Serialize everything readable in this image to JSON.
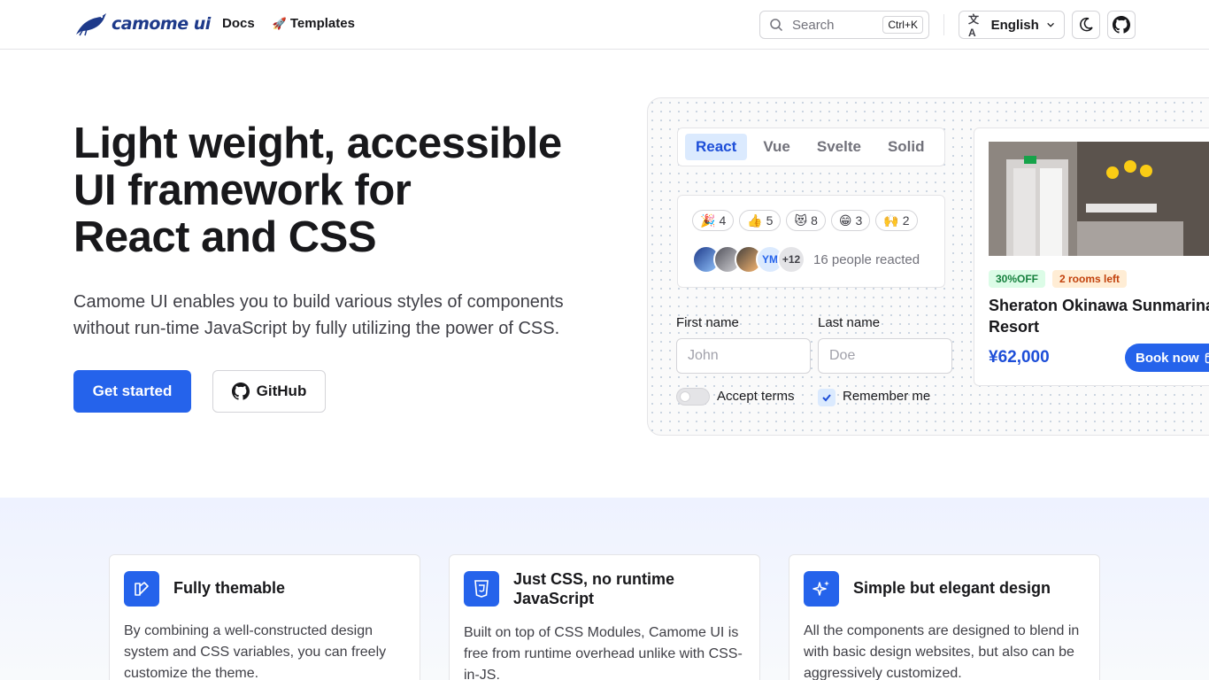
{
  "header": {
    "logo_text": "camome ui",
    "nav": [
      {
        "label": "Docs",
        "emoji": ""
      },
      {
        "label": "Templates",
        "emoji": "🚀"
      }
    ],
    "search": {
      "placeholder": "Search",
      "shortcut": "Ctrl+K"
    },
    "language": "English"
  },
  "hero": {
    "title_lines": [
      "Light weight, accessible",
      "UI framework for",
      "React and CSS"
    ],
    "subtitle": "Camome UI enables you to build various styles of components without run-time JavaScript by fully utilizing the power of CSS.",
    "primary_button": "Get started",
    "secondary_button": "GitHub"
  },
  "showcase": {
    "tabs": [
      "React",
      "Vue",
      "Svelte",
      "Solid"
    ],
    "active_tab": "React",
    "reactions": [
      {
        "emoji": "🎉",
        "count": "4"
      },
      {
        "emoji": "👍",
        "count": "5"
      },
      {
        "emoji": "😻",
        "count": "8"
      },
      {
        "emoji": "😁",
        "count": "3"
      },
      {
        "emoji": "🙌",
        "count": "2"
      }
    ],
    "avatar_initials": "YM",
    "avatar_more": "+12",
    "reacted_text": "16 people reacted",
    "form": {
      "first_name_label": "First name",
      "first_name_placeholder": "John",
      "last_name_label": "Last name",
      "last_name_placeholder": "Doe",
      "accept_terms": "Accept terms",
      "remember_me": "Remember me",
      "accept_terms_checked": false,
      "remember_me_checked": true
    },
    "hotel": {
      "discount_badge": "30%OFF",
      "rooms_badge": "2 rooms left",
      "name_lines": [
        "Sheraton Okinawa Sunmarina",
        "Resort"
      ],
      "price": "¥62,000",
      "book_button": "Book now"
    }
  },
  "features": [
    {
      "title": "Fully themable",
      "description": "By combining a well-constructed design system and CSS variables, you can freely customize the theme."
    },
    {
      "title": "Just CSS, no runtime JavaScript",
      "description": "Built on top of CSS Modules, Camome UI is free from runtime overhead unlike with CSS-in-JS."
    },
    {
      "title": "Simple but elegant design",
      "description": "All the components are designed to blend in with basic design websites, but also can be aggressively customized."
    }
  ],
  "colors": {
    "primary": "#2563eb",
    "text": "#18181b",
    "muted": "#71717a"
  }
}
